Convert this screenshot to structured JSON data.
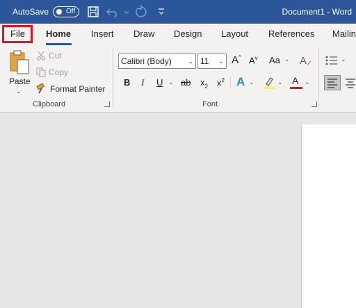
{
  "titlebar": {
    "autosave_label": "AutoSave",
    "autosave_state": "Off",
    "title": "Document1  -  Word",
    "accent": "#2b579a"
  },
  "tabs": [
    "File",
    "Home",
    "Insert",
    "Draw",
    "Design",
    "Layout",
    "References",
    "Mailin"
  ],
  "active_tab": "Home",
  "highlight_color": "#e81123",
  "clipboard": {
    "paste": "Paste",
    "cut": "Cut",
    "copy": "Copy",
    "format_painter": "Format Painter",
    "group_label": "Clipboard"
  },
  "font": {
    "font_name": "Calibri (Body)",
    "font_size": "11",
    "bold": "B",
    "italic": "I",
    "underline": "U",
    "strikethrough": "ab",
    "subscript_base": "x",
    "subscript_mark": "2",
    "superscript_base": "x",
    "superscript_mark": "2",
    "grow": "A",
    "shrink": "A",
    "change_case": "Aa",
    "text_effects": "A",
    "font_color": "A",
    "highlight_stroke": "#ffff00",
    "font_color_stroke": "#e81123",
    "group_label": "Font"
  }
}
